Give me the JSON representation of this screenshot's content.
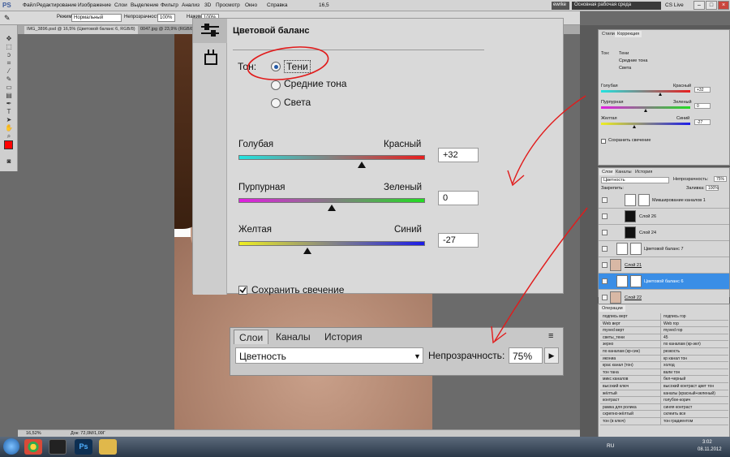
{
  "menu": {
    "logo": "PS",
    "items": [
      "Файл",
      "Редактирование",
      "Изображение",
      "Слои",
      "Выделение",
      "Фильтр",
      "Анализ",
      "3D",
      "Просмотр",
      "Окно",
      "Справка"
    ],
    "zoom": "16,5",
    "user": "ewrke",
    "workspace": "Основная рабочая среда",
    "cslive": "CS Live"
  },
  "options": {
    "mode_label": "Режим:",
    "mode_value": "Нормальный",
    "opacity_label": "Непрозрачность:",
    "opacity_value": "100%",
    "flow_label": "Нажим:",
    "flow_value": "100%"
  },
  "doc_tabs": [
    "IMG_3896.psd @ 16,5% (Цветовой баланс 6, RGB/8)",
    "0047.jpg @ 23,9% (RGB/8)"
  ],
  "color_balance": {
    "title": "Цветовой баланс",
    "tone_label": "Тон:",
    "tones": [
      "Тени",
      "Средние тона",
      "Света"
    ],
    "selected_tone": "Тени",
    "sliders": [
      {
        "left": "Голубая",
        "right": "Красный",
        "value": "+32",
        "level": 0.66,
        "from": "#22e3e0",
        "to": "#e81e1e"
      },
      {
        "left": "Пурпурная",
        "right": "Зеленый",
        "value": "0",
        "level": 0.5,
        "from": "#e11ee1",
        "to": "#22dd22"
      },
      {
        "left": "Желтая",
        "right": "Синий",
        "value": "-27",
        "level": 0.37,
        "from": "#eeee22",
        "to": "#1c1ce8"
      }
    ],
    "preserve_label": "Сохранить свечение",
    "preserve_checked": true
  },
  "zoomed_layers": {
    "tabs": [
      "Слои",
      "Каналы",
      "История"
    ],
    "blend": "Цветность",
    "opacity_label": "Непрозрачность:",
    "opacity_value": "75%"
  },
  "small_adjust": {
    "tabs": [
      "Стили",
      "Коррекция"
    ],
    "tone_label": "Тон:",
    "tones": [
      "Тени",
      "Средние тона",
      "Света"
    ],
    "sliders": [
      {
        "left": "Голубая",
        "right": "Красный",
        "value": "+32",
        "level": 0.66,
        "from": "#22e3e0",
        "to": "#e81e1e"
      },
      {
        "left": "Пурпурная",
        "right": "Зеленый",
        "value": "0",
        "level": 0.5,
        "from": "#e11ee1",
        "to": "#22dd22"
      },
      {
        "left": "Желтая",
        "right": "Синий",
        "value": "-27",
        "level": 0.37,
        "from": "#eeee22",
        "to": "#1c1ce8"
      }
    ],
    "preserve_label": "Сохранить свечение"
  },
  "layers": {
    "tabs": [
      "Слои",
      "Каналы",
      "История"
    ],
    "blend": "Цветность",
    "opacity_label": "Непрозрачность:",
    "opacity_value": "75%",
    "lock_label": "Закрепить:",
    "fill_label": "Заливка:",
    "fill_value": "100%",
    "rows": [
      {
        "name": "Микширование каналов 1",
        "selected": false
      },
      {
        "name": "Слой 26",
        "selected": false
      },
      {
        "name": "Слой 24",
        "selected": false
      },
      {
        "name": "Цветовой баланс 7",
        "selected": false
      },
      {
        "name": "Слой 21",
        "selected": false
      },
      {
        "name": "Цветовой баланс 6",
        "selected": true
      },
      {
        "name": "Слой 22",
        "selected": false
      }
    ]
  },
  "actions": {
    "tab": "Операции",
    "rows": [
      [
        "подпись верт",
        "подпись гор"
      ],
      [
        "Web верт",
        "Web гор"
      ],
      [
        "myved верт",
        "myved гор"
      ],
      [
        "светы_тени",
        "45"
      ],
      [
        "зерно",
        "по каналам (кр-зел)"
      ],
      [
        "по каналам (кр-син)",
        "резкость"
      ],
      [
        "икониа",
        "кр канал тон"
      ],
      [
        "крас канал (тон)",
        "холод"
      ],
      [
        "тон тана",
        "вали тон"
      ],
      [
        "микс каналов",
        "бел-черный"
      ],
      [
        "высокий ключ",
        "высокий контраст цвет тон"
      ],
      [
        "жёлтый",
        "каналы (красный+зеленый)"
      ],
      [
        "контраст",
        "голубое-корич"
      ],
      [
        "рамка для ролика",
        "синяя контраст"
      ],
      [
        "скрепно-жёлтый",
        "склеить все"
      ],
      [
        "тон (в ключ)",
        "тон градиентом"
      ]
    ]
  },
  "status": {
    "zoom": "16,52%",
    "doc": "Док: 72,0M/1,09Г"
  },
  "taskbar": {
    "lang": "RU",
    "time": "3:02",
    "date": "08.11.2012"
  },
  "colors": {
    "accent_blue": "#3a8ee6",
    "annotation_red": "#e11b1b",
    "foreground_swatch": "#ff0000",
    "background_swatch": "#ffffff"
  },
  "icons": [
    "photoshop-logo-icon",
    "brush-icon",
    "move-icon",
    "marquee-icon",
    "lasso-icon",
    "crop-icon",
    "eyedropper-icon",
    "eraser-icon",
    "gradient-icon",
    "pen-icon",
    "text-icon",
    "hand-icon",
    "zoom-icon",
    "adjustment-icon",
    "mask-icon",
    "eye-icon",
    "chrome-icon",
    "media-icon",
    "explorer-icon"
  ]
}
